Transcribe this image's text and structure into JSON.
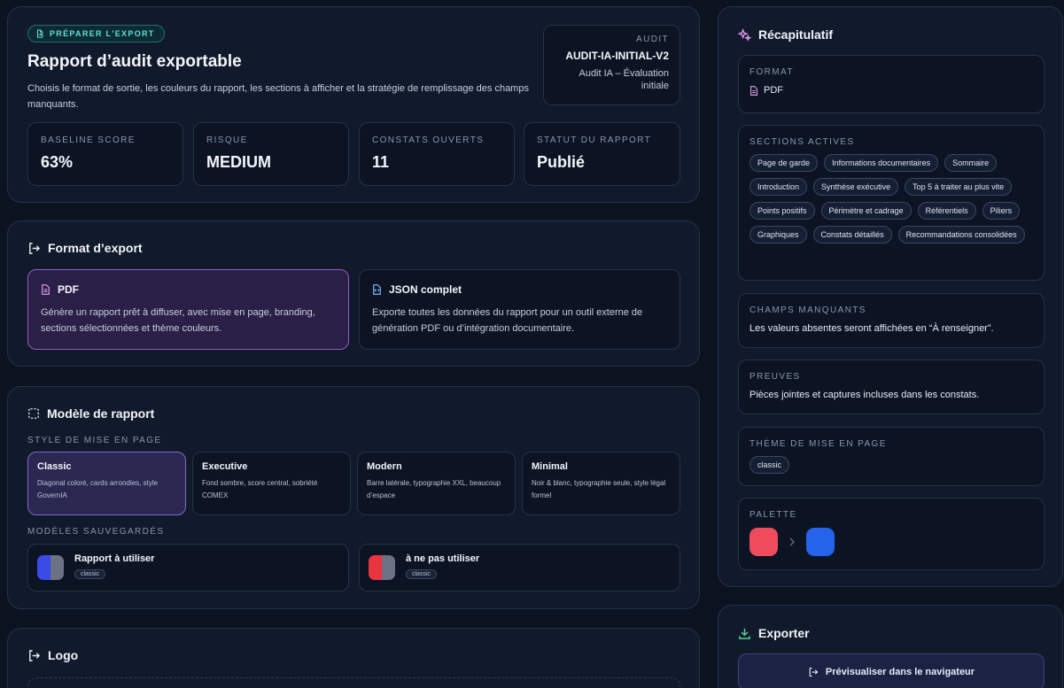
{
  "header": {
    "badge": "PRÉPARER L'EXPORT",
    "title": "Rapport d’audit exportable",
    "description": "Choisis le format de sortie, les couleurs du rapport, les sections à afficher et la stratégie de remplissage des champs manquants.",
    "audit_label": "AUDIT",
    "audit_id": "AUDIT-IA-INITIAL-V2",
    "audit_name": "Audit IA – Évaluation initiale",
    "stats": [
      {
        "label": "BASELINE SCORE",
        "value": "63%"
      },
      {
        "label": "RISQUE",
        "value": "MEDIUM"
      },
      {
        "label": "CONSTATS OUVERTS",
        "value": "11"
      },
      {
        "label": "STATUT DU RAPPORT",
        "value": "Publié"
      }
    ]
  },
  "format": {
    "title": "Format d’export",
    "options": [
      {
        "name": "PDF",
        "desc": "Génère un rapport prêt à diffuser, avec mise en page, branding, sections sélectionnées et thème couleurs.",
        "selected": true
      },
      {
        "name": "JSON complet",
        "desc": "Exporte toutes les données du rapport pour un outil externe de génération PDF ou d’intégration documentaire.",
        "selected": false
      }
    ]
  },
  "model": {
    "title": "Modèle de rapport",
    "style_label": "STYLE DE MISE EN PAGE",
    "styles": [
      {
        "name": "Classic",
        "desc": "Diagonal coloré, cards arrondies, style GovernIA",
        "selected": true
      },
      {
        "name": "Executive",
        "desc": "Fond sombre, score central, sobriété COMEX",
        "selected": false
      },
      {
        "name": "Modern",
        "desc": "Barre latérale, typographie XXL, beaucoup d’espace",
        "selected": false
      },
      {
        "name": "Minimal",
        "desc": "Noir & blanc, typographie seule, style légal formel",
        "selected": false
      }
    ],
    "saved_label": "MODÈLES SAUVEGARDÉS",
    "saved": [
      {
        "name": "Rapport à utiliser",
        "theme": "classic",
        "color_a": "#3b4be8",
        "color_b": "#6b7285"
      },
      {
        "name": "à ne pas utiliser",
        "theme": "classic",
        "color_a": "#e8343e",
        "color_b": "#6b7285"
      }
    ]
  },
  "logo": {
    "title": "Logo"
  },
  "recap": {
    "title": "Récapitulatif",
    "format_label": "FORMAT",
    "format_value": "PDF",
    "sections_label": "SECTIONS ACTIVES",
    "sections": [
      "Page de garde",
      "Informations documentaires",
      "Sommaire",
      "Introduction",
      "Synthèse exécutive",
      "Top 5 à traiter au plus vite",
      "Points positifs",
      "Périmètre et cadrage",
      "Référentiels",
      "Piliers",
      "Graphiques",
      "Constats détaillés",
      "Recommandations consolidées"
    ],
    "missing_label": "CHAMPS MANQUANTS",
    "missing_value": "Les valeurs absentes seront affichées en “À renseigner”.",
    "proofs_label": "PREUVES",
    "proofs_value": "Pièces jointes et captures incluses dans les constats.",
    "theme_label": "THÈME DE MISE EN PAGE",
    "theme_value": "classic",
    "palette_label": "PALETTE",
    "palette": [
      "#f04b5c",
      "#2563eb"
    ]
  },
  "export": {
    "title": "Exporter",
    "preview_button": "Prévisualiser dans le navigateur"
  }
}
